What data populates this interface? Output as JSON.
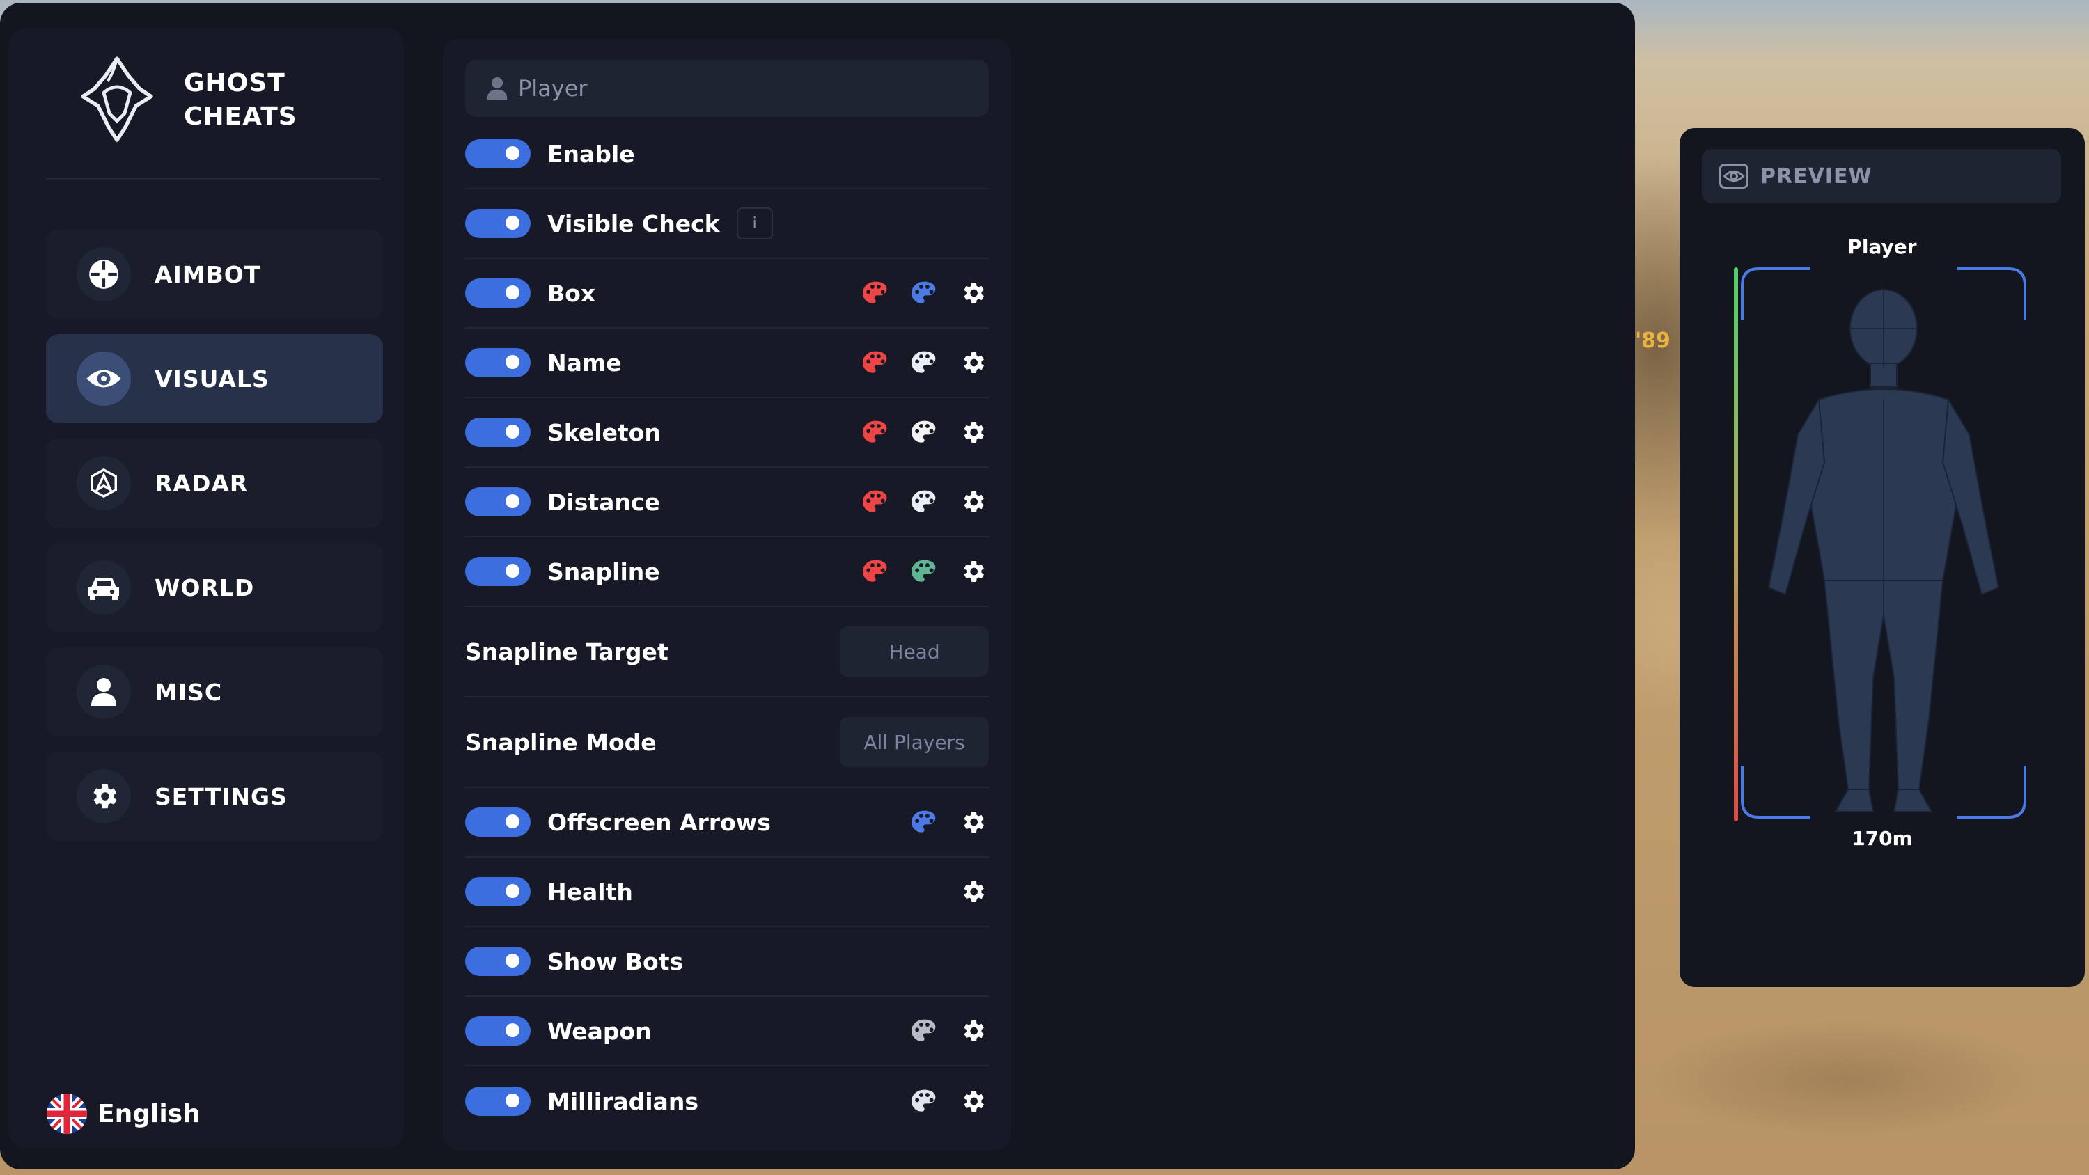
{
  "app": {
    "brand_line1": "GHOST",
    "brand_line2": "CHEATS"
  },
  "background": {
    "hud_text": "'89"
  },
  "sidebar": {
    "items": [
      {
        "label": "AIMBOT",
        "icon": "crosshair-icon",
        "active": false
      },
      {
        "label": "VISUALS",
        "icon": "eye-icon",
        "active": true
      },
      {
        "label": "RADAR",
        "icon": "radar-icon",
        "active": false
      },
      {
        "label": "WORLD",
        "icon": "car-icon",
        "active": false
      },
      {
        "label": "MISC",
        "icon": "user-icon",
        "active": false
      },
      {
        "label": "SETTINGS",
        "icon": "gear-icon",
        "active": false
      }
    ],
    "language": "English"
  },
  "visuals": {
    "section_title": "Player",
    "toggles": [
      {
        "label": "Enable",
        "on": true
      },
      {
        "label": "Visible Check",
        "on": true,
        "info": "i"
      },
      {
        "label": "Box",
        "on": true,
        "colors": [
          "#f04545",
          "#4b79e6"
        ]
      },
      {
        "label": "Name",
        "on": true,
        "colors": [
          "#f04545",
          "#e8eef5"
        ]
      },
      {
        "label": "Skeleton",
        "on": true,
        "colors": [
          "#f04545",
          "#f2f2f2"
        ]
      },
      {
        "label": "Distance",
        "on": true,
        "colors": [
          "#f04545",
          "#e8eef5"
        ]
      },
      {
        "label": "Snapline",
        "on": true,
        "colors": [
          "#f04545",
          "#5fb593"
        ]
      }
    ],
    "snapline_target": {
      "label": "Snapline Target",
      "value": "Head"
    },
    "snapline_mode": {
      "label": "Snapline Mode",
      "value": "All Players"
    },
    "toggles2": [
      {
        "label": "Offscreen Arrows",
        "on": true,
        "colors": [
          "#4b79e6"
        ]
      },
      {
        "label": "Health",
        "on": true
      },
      {
        "label": "Show Bots",
        "on": true
      },
      {
        "label": "Weapon",
        "on": true,
        "colors": [
          "#b7bcc6"
        ]
      },
      {
        "label": "Milliradians",
        "on": true,
        "colors": [
          "#e0e4ea"
        ]
      }
    ]
  },
  "preview": {
    "title": "PREVIEW",
    "player_label": "Player",
    "distance": "170m",
    "health_fraction": 1.0
  },
  "colors": {
    "accent": "#3c6ee0",
    "panel": "#171a26",
    "window": "#13151f",
    "box_corners": "#4b79e6"
  }
}
